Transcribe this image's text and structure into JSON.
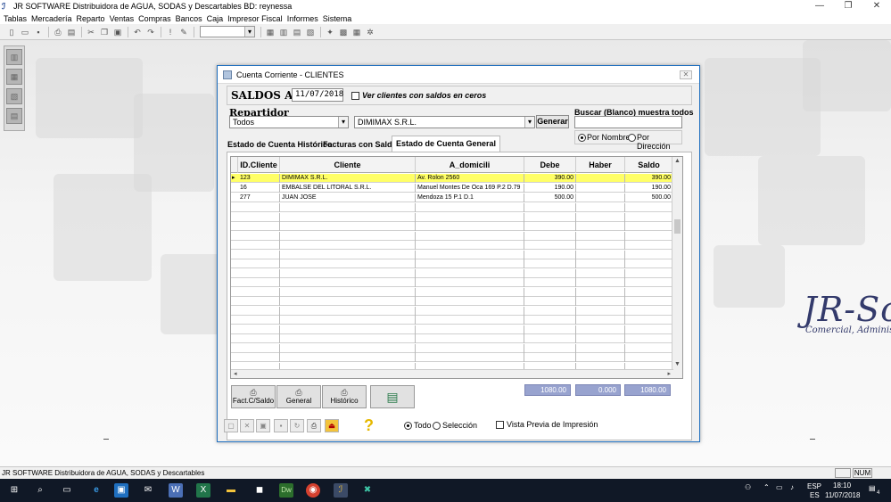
{
  "window": {
    "title": "JR SOFTWARE Distribuidora de AGUA, SODAS y Descartables BD: reynessa",
    "min_icon": "minimize-icon",
    "max_icon": "maximize-icon",
    "close_icon": "close-icon"
  },
  "menu": [
    "Tablas",
    "Mercadería",
    "Reparto",
    "Ventas",
    "Compras",
    "Bancos",
    "Caja",
    "Impresor Fiscal",
    "Informes",
    "Sistema"
  ],
  "brand": {
    "logo": "JR-So",
    "tagline": "Comercial, Administr"
  },
  "dialog": {
    "title": "Cuenta Corriente - CLIENTES",
    "saldos_label": "SALDOS AL:",
    "saldos_date": "11/07/2018",
    "ver_clientes_label": "Ver clientes con saldos en ceros",
    "repartidor_label": "Repartidor",
    "repartidor_value": "Todos",
    "cliente_value": "DIMIMAX S.R.L.",
    "generar_label": "Generar",
    "buscar_label": "Buscar (Blanco) muestra todos",
    "buscar_value": "",
    "radio_nombre": "Por Nombre",
    "radio_direccion": "Por Dirección",
    "tabs": [
      "Estado de Cuenta Histórico",
      "Facturas con Saldos",
      "Estado de Cuenta General"
    ],
    "columns": [
      "ID.Cliente",
      "Cliente",
      "A_domicili",
      "Debe",
      "Haber",
      "Saldo"
    ],
    "rows": [
      [
        "123",
        "DIMIMAX S.R.L.",
        "Av. Rolon 2560",
        "390.00",
        "",
        "390.00"
      ],
      [
        "16",
        "EMBALSE DEL LITORAL S.R.L.",
        "Manuel Montes De Oca 169 P.2 D.79",
        "190.00",
        "",
        "190.00"
      ],
      [
        "277",
        "JUAN JOSE",
        "Mendoza 15 P.1 D.1",
        "500.00",
        "",
        "500.00"
      ]
    ],
    "totals": {
      "debe": "1080.00",
      "haber": "0.000",
      "saldo": "1080.00"
    },
    "buttons": {
      "fact": "Fact.C/Saldo",
      "general": "General",
      "historico": "Histórico"
    },
    "radio_todo": "Todo",
    "radio_seleccion": "Selección",
    "vista_previa": "Vista Previa de Impresión"
  },
  "statusbar": {
    "text": "JR SOFTWARE Distribuidora de AGUA, SODAS y Descartables",
    "num": "NUM"
  },
  "taskbar": {
    "lang1": "ESP",
    "lang2": "ES",
    "time": "18:10",
    "date": "11/07/2018",
    "notif_count": "4"
  }
}
